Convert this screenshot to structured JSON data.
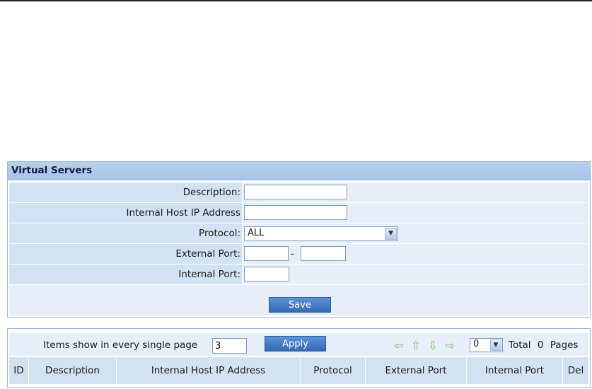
{
  "panel": {
    "title": "Virtual Servers"
  },
  "form": {
    "description_label": "Description:",
    "description_value": "",
    "host_ip_label": "Internal Host IP Address",
    "host_ip_value": "",
    "protocol_label": "Protocol:",
    "protocol_value": "ALL",
    "external_port_label": "External Port:",
    "external_port_start": "",
    "external_port_separator": "-",
    "external_port_end": "",
    "internal_port_label": "Internal Port:",
    "internal_port_value": "",
    "save_label": "Save"
  },
  "pager": {
    "items_label": "Items show in every single page",
    "items_value": "3",
    "apply_label": "Apply",
    "page_value": "0",
    "total_prefix": "Total",
    "total_pages": "0",
    "total_suffix": "Pages",
    "nav_icons": [
      "arrow-left-icon",
      "arrow-up-icon",
      "arrow-down-icon",
      "arrow-right-icon"
    ]
  },
  "table": {
    "columns": [
      "ID",
      "Description",
      "Internal Host IP Address",
      "Protocol",
      "External Port",
      "Internal Port",
      "Del"
    ],
    "rows": []
  }
}
